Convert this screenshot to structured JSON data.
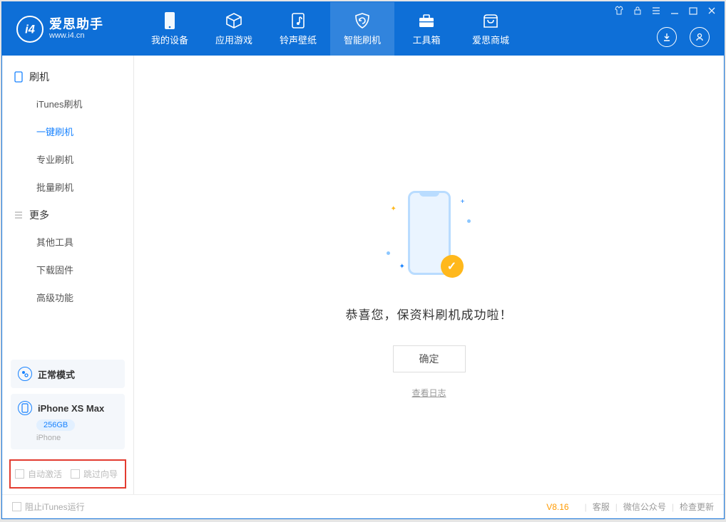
{
  "app": {
    "name": "爱思助手",
    "url": "www.i4.cn"
  },
  "nav": {
    "tabs": [
      {
        "label": "我的设备"
      },
      {
        "label": "应用游戏"
      },
      {
        "label": "铃声壁纸"
      },
      {
        "label": "智能刷机"
      },
      {
        "label": "工具箱"
      },
      {
        "label": "爱思商城"
      }
    ]
  },
  "sidebar": {
    "section1_title": "刷机",
    "items1": [
      {
        "label": "iTunes刷机"
      },
      {
        "label": "一键刷机"
      },
      {
        "label": "专业刷机"
      },
      {
        "label": "批量刷机"
      }
    ],
    "section2_title": "更多",
    "items2": [
      {
        "label": "其他工具"
      },
      {
        "label": "下载固件"
      },
      {
        "label": "高级功能"
      }
    ],
    "mode_card": {
      "label": "正常模式"
    },
    "device_card": {
      "name": "iPhone XS Max",
      "storage": "256GB",
      "type": "iPhone"
    },
    "checkboxes": {
      "auto_activate": "自动激活",
      "skip_guide": "跳过向导"
    }
  },
  "main": {
    "success_text": "恭喜您，保资料刷机成功啦！",
    "ok_button": "确定",
    "view_log": "查看日志"
  },
  "footer": {
    "block_itunes": "阻止iTunes运行",
    "version": "V8.16",
    "customer_service": "客服",
    "wechat": "微信公众号",
    "check_update": "检查更新"
  }
}
